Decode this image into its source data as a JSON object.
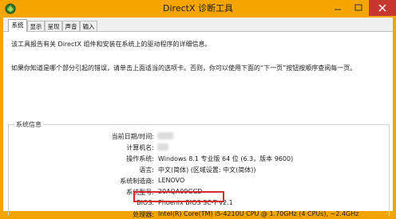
{
  "window": {
    "title": "DirectX 诊断工具",
    "accent": "#f5a400",
    "close_color": "#c7372f"
  },
  "tabs": [
    {
      "label": "系统",
      "active": true
    },
    {
      "label": "显示",
      "active": false
    },
    {
      "label": "呈现",
      "active": false
    },
    {
      "label": "声音",
      "active": false
    },
    {
      "label": "输入",
      "active": false
    }
  ],
  "intro": {
    "line1": "该工具报告有关 DirectX 组件和安装在系统上的驱动程序的详细信息。",
    "line2": "如果你知道是哪个部分引起的错误，请单击上面适当的选项卡。否则，你可以使用下面的“下一页”按钮按顺序查阅每一页。"
  },
  "system_info": {
    "group_title": "系统信息",
    "rows": [
      {
        "label": "当前日期/时间:",
        "value": ""
      },
      {
        "label": "计算机名:",
        "value": ""
      },
      {
        "label": "操作系统:",
        "value": "Windows 8.1 专业版 64 位 (6.3，版本 9600)"
      },
      {
        "label": "语言:",
        "value": "中文(简体) (区域设置: 中文(简体))"
      },
      {
        "label": "系统制造商:",
        "value": "LENOVO"
      },
      {
        "label": "系统型号:",
        "value": "20AQA09GCD"
      },
      {
        "label": "BIOS:",
        "value": "Phoenix BIOS SC-T v2.1"
      },
      {
        "label": "处理器:",
        "value": "Intel(R) Core(TM) i5-4210U CPU @ 1.70GHz (4 CPUs), ~2.4GHz"
      }
    ],
    "highlight_color": "#d92b2b"
  }
}
